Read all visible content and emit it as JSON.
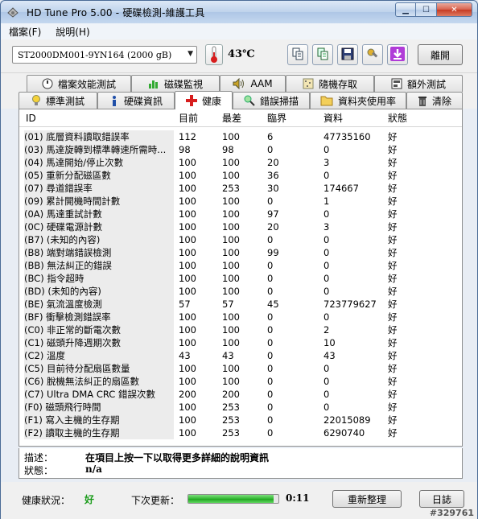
{
  "window": {
    "title": "HD Tune Pro 5.00 - 硬碟檢測-維護工具"
  },
  "menu": {
    "items": [
      "檔案(F)",
      "說明(H)"
    ]
  },
  "toolbar": {
    "drive": "ST2000DM001-9YN164 (2000 gB)",
    "temperature": "43℃",
    "exit_label": "離開"
  },
  "tabs": {
    "row1": [
      "檔案效能測試",
      "磁碟監視",
      "AAM",
      "隨機存取",
      "額外測試"
    ],
    "row2": [
      "標準測試",
      "硬碟資訊",
      "健康",
      "錯誤掃描",
      "資料夾使用率",
      "清除"
    ],
    "active": "健康"
  },
  "table": {
    "headers": [
      "ID",
      "目前",
      "最差",
      "臨界",
      "資料",
      "狀態"
    ],
    "rows": [
      [
        "(01) 底層資料讀取錯誤率",
        "112",
        "100",
        "6",
        "47735160",
        "好"
      ],
      [
        "(03) 馬達旋轉到標準轉速所需時...",
        "98",
        "98",
        "0",
        "0",
        "好"
      ],
      [
        "(04) 馬達開始/停止次數",
        "100",
        "100",
        "20",
        "3",
        "好"
      ],
      [
        "(05) 重新分配磁區數",
        "100",
        "100",
        "36",
        "0",
        "好"
      ],
      [
        "(07) 尋道錯誤率",
        "100",
        "253",
        "30",
        "174667",
        "好"
      ],
      [
        "(09) 累計開機時間計數",
        "100",
        "100",
        "0",
        "1",
        "好"
      ],
      [
        "(0A) 馬達重試計數",
        "100",
        "100",
        "97",
        "0",
        "好"
      ],
      [
        "(0C) 硬碟電源計數",
        "100",
        "100",
        "20",
        "3",
        "好"
      ],
      [
        "(B7) (未知的內容)",
        "100",
        "100",
        "0",
        "0",
        "好"
      ],
      [
        "(B8) 端對端錯誤檢測",
        "100",
        "100",
        "99",
        "0",
        "好"
      ],
      [
        "(BB) 無法糾正的錯誤",
        "100",
        "100",
        "0",
        "0",
        "好"
      ],
      [
        "(BC) 指令超時",
        "100",
        "100",
        "0",
        "0",
        "好"
      ],
      [
        "(BD) (未知的內容)",
        "100",
        "100",
        "0",
        "0",
        "好"
      ],
      [
        "(BE) 氣流溫度檢測",
        "57",
        "57",
        "45",
        "723779627",
        "好"
      ],
      [
        "(BF) 衝擊檢測錯誤率",
        "100",
        "100",
        "0",
        "0",
        "好"
      ],
      [
        "(C0) 非正常的斷電次數",
        "100",
        "100",
        "0",
        "2",
        "好"
      ],
      [
        "(C1) 磁頭升降週期次數",
        "100",
        "100",
        "0",
        "10",
        "好"
      ],
      [
        "(C2) 溫度",
        "43",
        "43",
        "0",
        "43",
        "好"
      ],
      [
        "(C5) 目前待分配扇區數量",
        "100",
        "100",
        "0",
        "0",
        "好"
      ],
      [
        "(C6) 脫機無法糾正的扇區數",
        "100",
        "100",
        "0",
        "0",
        "好"
      ],
      [
        "(C7) Ultra DMA CRC 錯誤次數",
        "200",
        "200",
        "0",
        "0",
        "好"
      ],
      [
        "(F0) 磁頭飛行時間",
        "100",
        "253",
        "0",
        "0",
        "好"
      ],
      [
        "(F1) 寫入主機的生存期",
        "100",
        "253",
        "0",
        "22015089",
        "好"
      ],
      [
        "(F2) 讀取主機的生存期",
        "100",
        "253",
        "0",
        "6290740",
        "好"
      ]
    ]
  },
  "info": {
    "desc_label": "描述：",
    "desc_value": "在項目上按一下以取得更多詳細的說明資訊",
    "status_label": "狀態：",
    "status_value": "n/a"
  },
  "bottom": {
    "health_label": "健康狀況：",
    "health_value": "好",
    "next_update_label": "下次更新：",
    "progress_fraction": 0.95,
    "countdown": "0:11",
    "refresh_label": "重新整理",
    "log_label": "日誌"
  },
  "watermark": "#329761",
  "colors": {
    "health_ok": "#1a9b1a",
    "accent_red": "#d71d1d"
  }
}
